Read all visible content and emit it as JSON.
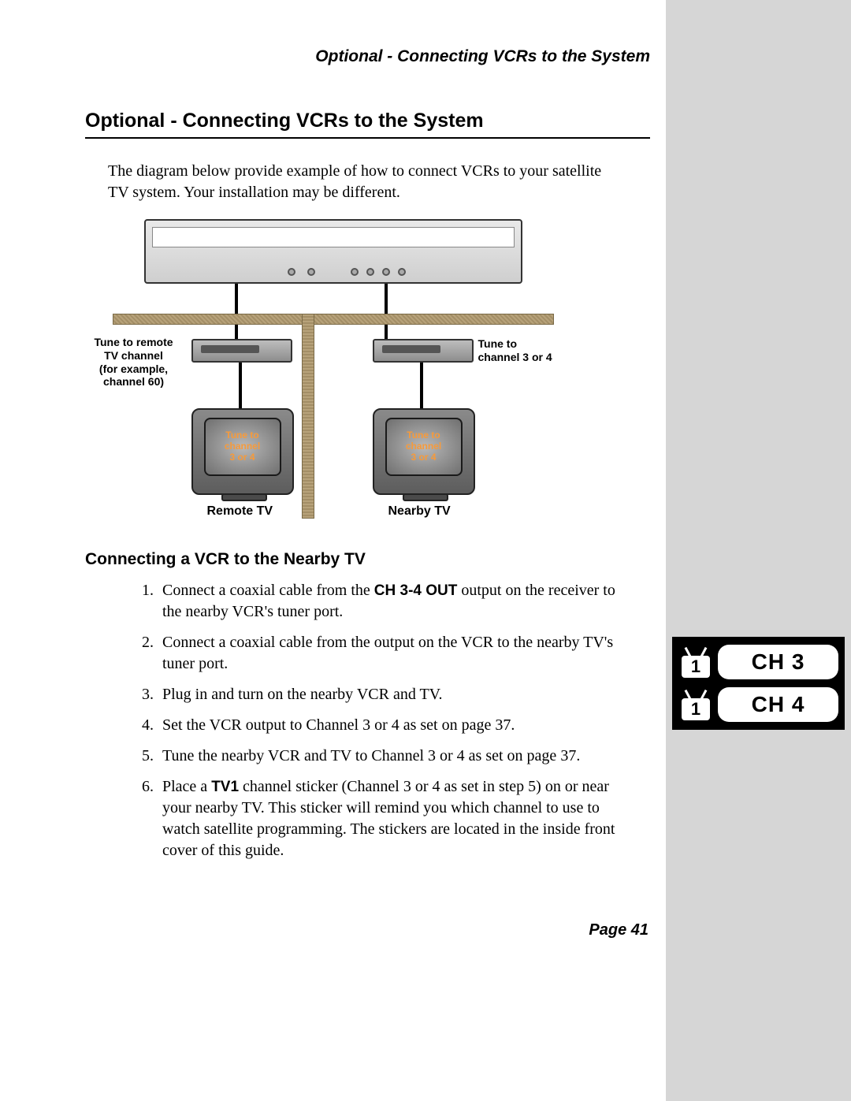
{
  "running_head": "Optional - Connecting VCRs to the System",
  "section_title": "Optional - Connecting VCRs to the System",
  "intro": "The diagram below provide example of how to connect VCRs to your satellite TV system. Your installation may be different.",
  "diagram": {
    "label_left": "Tune to remote\nTV channel\n(for example,\nchannel 60)",
    "label_right": "Tune to\nchannel 3 or 4",
    "tv_text": "Tune to\nchannel\n3 or 4",
    "caption_left": "Remote TV",
    "caption_right": "Nearby TV"
  },
  "subhead": "Connecting a VCR to the Nearby TV",
  "steps": [
    {
      "pre": "Connect a coaxial cable from the ",
      "bold": "CH 3-4 OUT",
      "post": " output on the receiver to the nearby VCR's tuner port."
    },
    {
      "text": "Connect a coaxial cable from the output on the VCR to the nearby TV's tuner port."
    },
    {
      "text": "Plug in and turn on the nearby VCR and TV."
    },
    {
      "text": "Set the VCR output to Channel 3 or 4 as set on page 37."
    },
    {
      "text": "Tune the nearby VCR and TV to Channel 3 or 4 as set on page 37."
    },
    {
      "pre": "Place a ",
      "bold": "TV1",
      "post": " channel sticker (Channel 3 or 4 as set in step 5) on or near your nearby TV. This sticker will remind you which channel to use to watch satellite programming. The stickers are located in the inside front cover of this guide."
    }
  ],
  "stickers": {
    "tv_number": "1",
    "rows": [
      "CH 3",
      "CH 4"
    ]
  },
  "page_label": "Page 41"
}
